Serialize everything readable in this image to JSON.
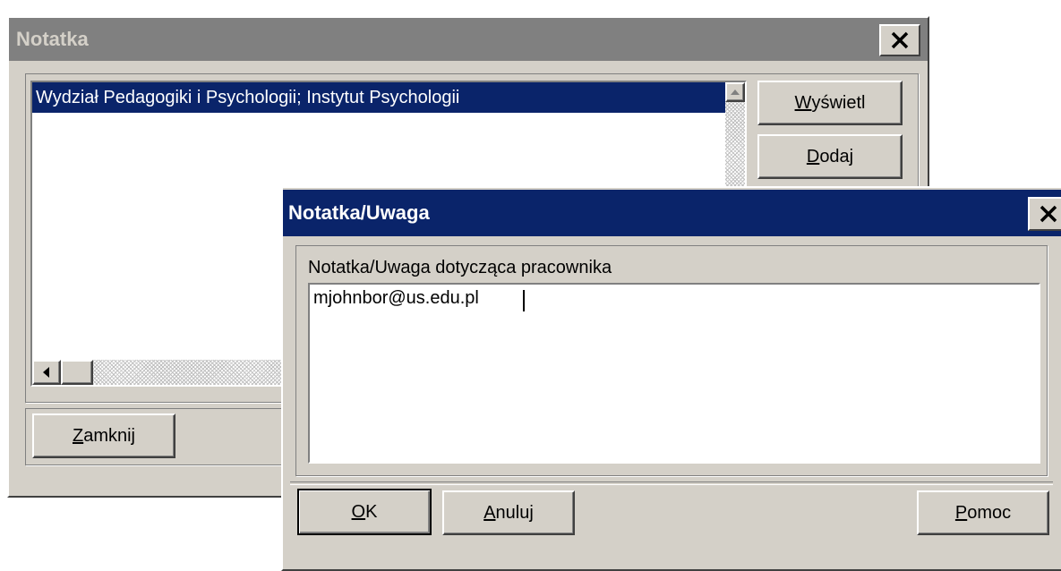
{
  "note_window": {
    "title": "Notatka",
    "list_items": [
      "Wydział Pedagogiki i Psychologii; Instytut Psychologii"
    ],
    "buttons": {
      "show": {
        "key": "W",
        "rest": "yświetl"
      },
      "add": {
        "key": "D",
        "rest": "odaj"
      },
      "close": {
        "key": "Z",
        "rest": "amknij"
      }
    },
    "colors": {
      "titlebar": "#808080",
      "selection": "#0a246a"
    }
  },
  "note_dialog": {
    "title": "Notatka/Uwaga",
    "field_label": "Notatka/Uwaga dotycząca pracownika",
    "field_value": "mjohnbor@us.edu.pl",
    "buttons": {
      "ok": {
        "key": "O",
        "rest": "K"
      },
      "cancel": {
        "key": "A",
        "rest": "nuluj"
      },
      "help": {
        "key": "P",
        "rest": "omoc"
      }
    },
    "colors": {
      "titlebar": "#0a246a"
    }
  },
  "icons": {
    "close": "close-icon",
    "scroll_up": "arrow-up-icon",
    "scroll_left": "arrow-left-icon"
  }
}
